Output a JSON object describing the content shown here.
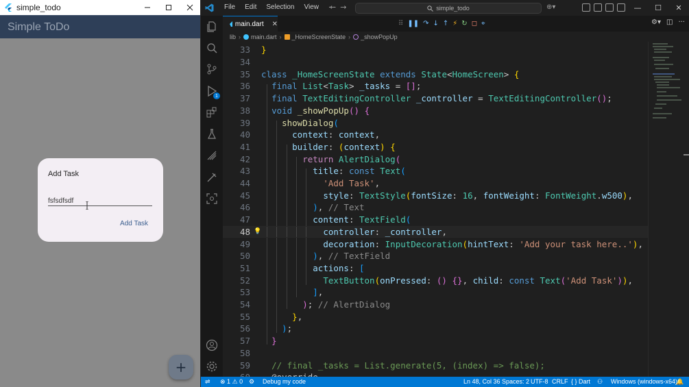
{
  "app": {
    "window_title": "simple_todo",
    "appbar_title": "Simple ToDo",
    "dialog": {
      "title": "Add Task",
      "input_value": "fsfsdfsdf",
      "button_label": "Add Task"
    },
    "fab_label": "+"
  },
  "vscode": {
    "menu": [
      "File",
      "Edit",
      "Selection",
      "View",
      "···"
    ],
    "search_text": "simple_todo",
    "tab_name": "main.dart",
    "breadcrumb": [
      "lib",
      "main.dart",
      "_HomeScreenState",
      "_showPopUp"
    ],
    "status": {
      "errors": "1",
      "warnings": "0",
      "debug": "Debug my code",
      "position": "Ln 48, Col 36",
      "spaces": "Spaces: 2",
      "encoding": "UTF-8",
      "eol": "CRLF",
      "language": "Dart",
      "device": "Windows (windows-x64)"
    },
    "activity_badge": "1",
    "line_numbers": [
      "33",
      "34",
      "35",
      "36",
      "37",
      "38",
      "39",
      "40",
      "41",
      "42",
      "43",
      "44",
      "45",
      "46",
      "47",
      "48",
      "49",
      "50",
      "51",
      "52",
      "53",
      "54",
      "55",
      "56",
      "57",
      "58",
      "59",
      "60"
    ],
    "active_line": "48"
  },
  "colors": {
    "appbar": "#2e3f58",
    "accent": "#0078d4",
    "dialog_bg": "#f3eef4"
  }
}
